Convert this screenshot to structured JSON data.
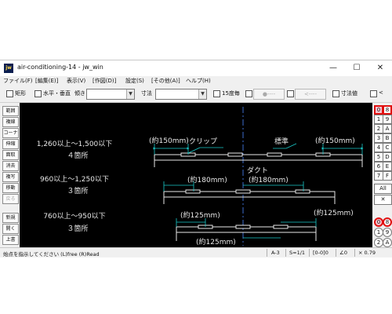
{
  "window": {
    "title": "air-conditioning-14 - jw_win",
    "icon_text": "jw",
    "minimize_glyph": "—",
    "maximize_glyph": "☐",
    "close_glyph": "✕"
  },
  "menubar": {
    "items": [
      {
        "label": "ファイル(F)"
      },
      {
        "label": "[編集(E)]"
      },
      {
        "label": "表示(V)"
      },
      {
        "label": "[作図(D)]"
      },
      {
        "label": "設定(S)"
      },
      {
        "label": "[その他(A)]"
      },
      {
        "label": "ヘルプ(H)"
      }
    ]
  },
  "toolbar": {
    "rect_label": "矩形",
    "hv_label": "水平・垂直",
    "slope_label": "傾き",
    "dim_label": "寸法",
    "deg15_label": "15度毎",
    "dot_button": "●----",
    "arrow_button": "<----",
    "dimval_label": "寸法値",
    "last_label": "<"
  },
  "left_panel": {
    "buttons": [
      {
        "label": "範囲",
        "enabled": true
      },
      {
        "label": "複線",
        "enabled": true
      },
      {
        "label": "コーナー",
        "enabled": true
      },
      {
        "label": "伸縮",
        "enabled": true
      },
      {
        "label": "面取",
        "enabled": true
      },
      {
        "label": "消去",
        "enabled": true
      },
      {
        "label": "複写",
        "enabled": true
      },
      {
        "label": "移動",
        "enabled": true
      },
      {
        "label": "戻る",
        "enabled": false
      },
      {
        "label": "新規",
        "enabled": true
      },
      {
        "label": "開く",
        "enabled": true
      },
      {
        "label": "上書",
        "enabled": true
      }
    ]
  },
  "right_panel": {
    "rows": [
      [
        "0",
        "8"
      ],
      [
        "1",
        "9"
      ],
      [
        "2",
        "A"
      ],
      [
        "3",
        "B"
      ],
      [
        "4",
        "C"
      ],
      [
        "5",
        "D"
      ],
      [
        "6",
        "E"
      ],
      [
        "7",
        "F"
      ]
    ],
    "all_label": "All",
    "x_label": "✕",
    "bottom": [
      "0",
      "8",
      "1",
      "9",
      "2",
      "A"
    ]
  },
  "canvas": {
    "labels": [
      {
        "text": "1,260以上～1,500以下"
      },
      {
        "text": "４箇所"
      },
      {
        "text": "960以上～1,250以下"
      },
      {
        "text": "３箇所"
      },
      {
        "text": "760以上～950以下"
      },
      {
        "text": "３箇所"
      }
    ],
    "annotations": {
      "clip": "クリップ",
      "standard": "標準",
      "duct": "ダクト",
      "d150a": "(約150mm)",
      "d150b": "(約150mm)",
      "d180a": "(約180mm)",
      "d180b": "(約180mm)",
      "d125a": "(約125mm)",
      "d125b": "(約125mm)",
      "d125c": "(約125mm)"
    },
    "colors": {
      "drawing": "#e8e8e8",
      "dimension": "#19c9c9",
      "center": "#4b86ff"
    }
  },
  "statusbar": {
    "message": "始点を指示してください (L)free (R)Read",
    "paper": "A-3",
    "scale": "S=1/1",
    "layer": "[0-0]0",
    "angle": "∠0",
    "zoom": "× 0.79"
  }
}
